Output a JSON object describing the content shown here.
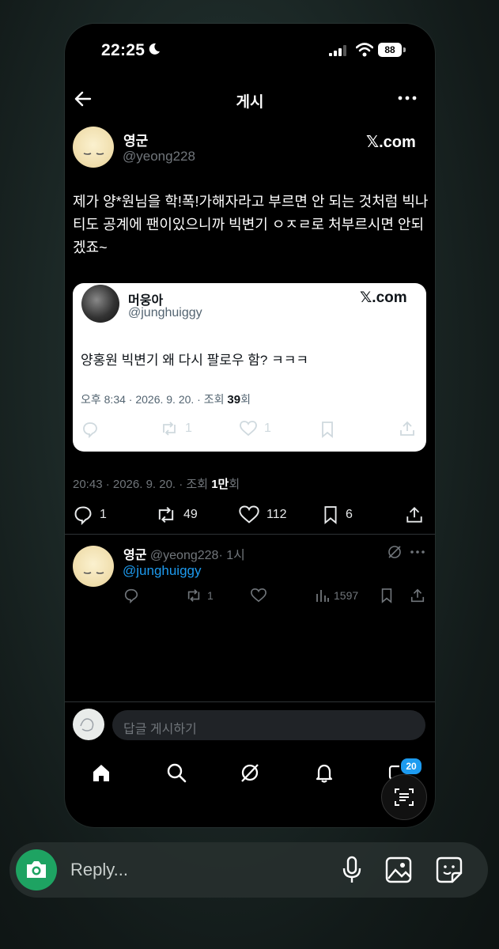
{
  "status": {
    "time": "22:25",
    "battery": "88"
  },
  "nav": {
    "title": "게시"
  },
  "post": {
    "author_name": "영군",
    "author_handle": "@yeong228",
    "brand": "𝕏.com",
    "text": "제가 양*원님을 학!폭!가해자라고 부르면 안 되는 것처럼 빅나티도 공계에 팬이있으니까 빅변기 ㅇㅈㄹ로 처부르시면 안되겠죠~",
    "meta_prefix": "20:43 · 2026. 9. 20. · 조회 ",
    "meta_views": "1만",
    "meta_suffix": "회",
    "replies": "1",
    "reposts": "49",
    "likes": "112",
    "bookmarks": "6"
  },
  "quote": {
    "author_name": "머웅아",
    "author_handle": "@junghuiggy",
    "brand": "𝕏.com",
    "text": "양홍원 빅변기 왜 다시 팔로우 함? ㅋㅋㅋ",
    "meta_prefix": "오후 8:34 · 2026. 9. 20. · 조회 ",
    "meta_views": "39",
    "meta_suffix": "회",
    "reposts": "1",
    "likes": "1"
  },
  "reply": {
    "author_name": "영군",
    "author_handle": "@yeong228",
    "time": "· 1시",
    "mention": "@junghuiggy",
    "reposts": "1",
    "views": "1597"
  },
  "composer": {
    "placeholder": "답글 게시하기"
  },
  "tabbar": {
    "messages_badge": "20"
  },
  "outer": {
    "reply_placeholder": "Reply..."
  },
  "colors": {
    "accent": "#1d9bf0",
    "camera": "#1ea362",
    "background": "#000000"
  }
}
